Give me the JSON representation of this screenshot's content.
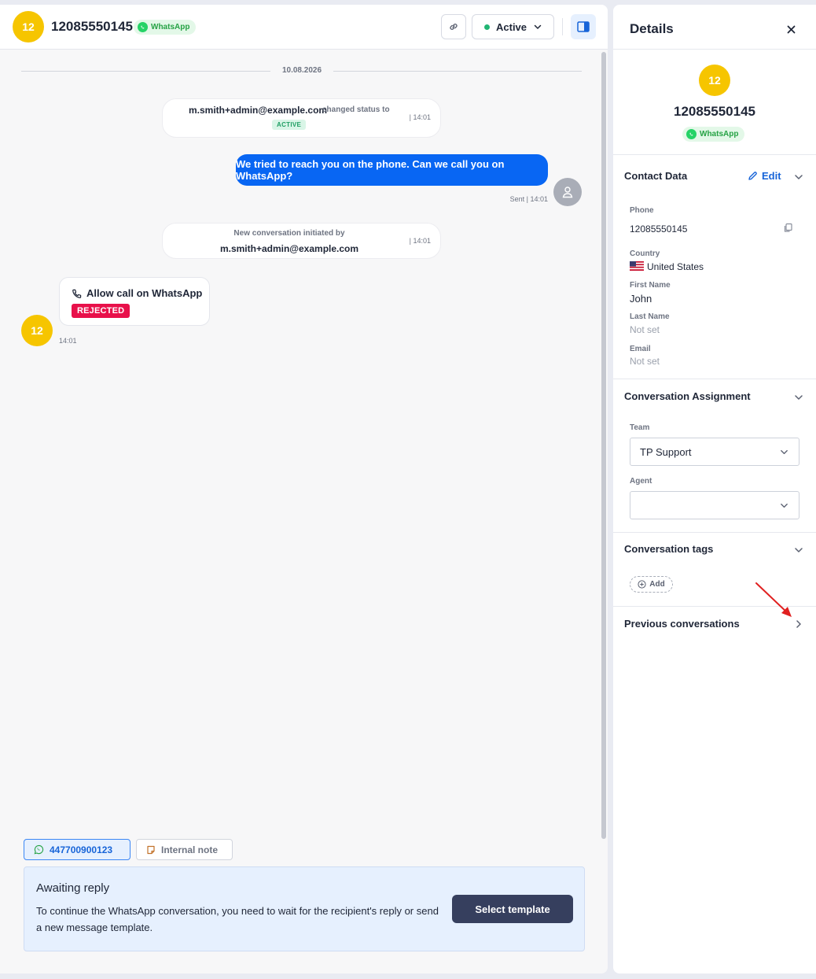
{
  "header": {
    "avatar_initials": "12",
    "phone": "12085550145",
    "channel_badge": "WhatsApp",
    "status_label": "Active",
    "status_color": "#21b573",
    "icons": [
      "link-icon",
      "chevron-down-icon",
      "sidebar-panel-icon"
    ]
  },
  "timeline": {
    "date": "10.08.2026",
    "status_change": {
      "user": "m.smith+admin@example.com",
      "action": "changed status to",
      "status": "ACTIVE",
      "time": "| 14:01"
    },
    "outgoing_message": {
      "text": "We tried to reach you on the phone. Can we call you on WhatsApp?",
      "meta": "Sent | 14:01"
    },
    "conversation_initiated": {
      "line1": "New conversation initiated by",
      "line2": "m.smith+admin@example.com",
      "time": "| 14:01"
    },
    "incoming_message": {
      "title": "Allow call on WhatsApp",
      "badge": "REJECTED",
      "avatar_initials": "12",
      "time": "14:01"
    }
  },
  "composer": {
    "channel_tab": "447700900123",
    "note_tab": "Internal note",
    "awaiting": {
      "title": "Awaiting reply",
      "text": "To continue the WhatsApp conversation, you need to wait for the recipient's reply or send a new message template.",
      "button": "Select template"
    }
  },
  "details": {
    "title": "Details",
    "avatar_initials": "12",
    "phone": "12085550145",
    "channel_badge": "WhatsApp",
    "contact_data": {
      "title": "Contact Data",
      "edit_label": "Edit",
      "phone_label": "Phone",
      "phone_value": "12085550145",
      "country_label": "Country",
      "country_value": "United States",
      "first_name_label": "First Name",
      "first_name_value": "John",
      "last_name_label": "Last Name",
      "last_name_value": "Not set",
      "email_label": "Email",
      "email_value": "Not set"
    },
    "assignment": {
      "title": "Conversation Assignment",
      "team_label": "Team",
      "team_value": "TP Support",
      "agent_label": "Agent",
      "agent_value": ""
    },
    "tags": {
      "title": "Conversation tags",
      "add_label": "Add"
    },
    "previous": {
      "title": "Previous conversations"
    }
  },
  "colors": {
    "accent_blue": "#0866f3",
    "avatar_yellow": "#f6c500",
    "rejected_red": "#e8104a",
    "whatsapp_green": "#25d366"
  }
}
